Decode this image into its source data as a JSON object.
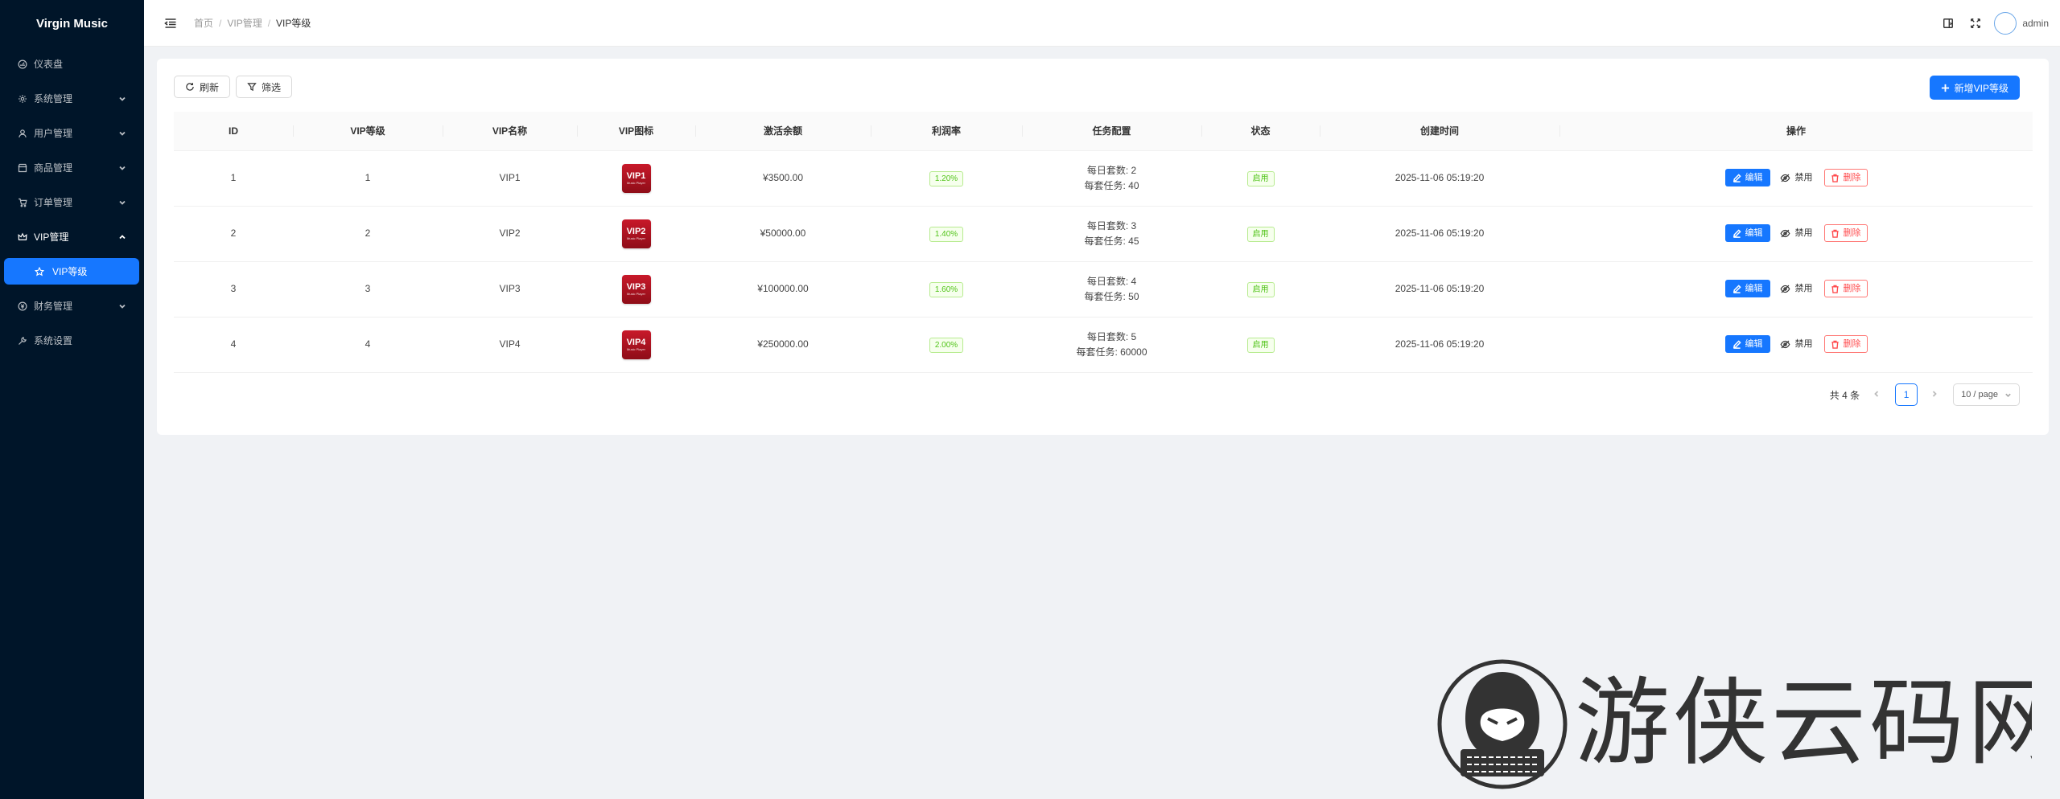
{
  "app": {
    "title": "Virgin Music"
  },
  "sidebar": {
    "items": [
      {
        "label": "仪表盘",
        "icon": "dashboard-icon",
        "expandable": false
      },
      {
        "label": "系统管理",
        "icon": "settings-icon",
        "expandable": true
      },
      {
        "label": "用户管理",
        "icon": "user-icon",
        "expandable": true
      },
      {
        "label": "商品管理",
        "icon": "shop-icon",
        "expandable": true
      },
      {
        "label": "订单管理",
        "icon": "cart-icon",
        "expandable": true
      },
      {
        "label": "VIP管理",
        "icon": "crown-icon",
        "expandable": true,
        "open": true
      },
      {
        "label": "财务管理",
        "icon": "finance-icon",
        "expandable": true
      },
      {
        "label": "系统设置",
        "icon": "wrench-icon",
        "expandable": false
      }
    ],
    "active_sub": {
      "label": "VIP等级",
      "icon": "star-icon"
    }
  },
  "header": {
    "breadcrumb": [
      "首页",
      "VIP管理",
      "VIP等级"
    ],
    "separator": "/",
    "username": "admin"
  },
  "toolbar": {
    "refresh_label": "刷新",
    "filter_label": "筛选",
    "add_label": "新增VIP等级"
  },
  "table": {
    "columns": [
      "ID",
      "VIP等级",
      "VIP名称",
      "VIP图标",
      "激活余额",
      "利润率",
      "任务配置",
      "状态",
      "创建时间",
      "操作"
    ],
    "rows": [
      {
        "id": "1",
        "level": "1",
        "name": "VIP1",
        "icon_text": "VIP1",
        "icon_sub": "Music Player",
        "balance": "¥3500.00",
        "rate": "1.20%",
        "task_daily": "每日套数: 2",
        "task_per": "每套任务: 40",
        "status": "启用",
        "created": "2025-11-06 05:19:20"
      },
      {
        "id": "2",
        "level": "2",
        "name": "VIP2",
        "icon_text": "VIP2",
        "icon_sub": "Music Player",
        "balance": "¥50000.00",
        "rate": "1.40%",
        "task_daily": "每日套数: 3",
        "task_per": "每套任务: 45",
        "status": "启用",
        "created": "2025-11-06 05:19:20"
      },
      {
        "id": "3",
        "level": "3",
        "name": "VIP3",
        "icon_text": "VIP3",
        "icon_sub": "Music Player",
        "balance": "¥100000.00",
        "rate": "1.60%",
        "task_daily": "每日套数: 4",
        "task_per": "每套任务: 50",
        "status": "启用",
        "created": "2025-11-06 05:19:20"
      },
      {
        "id": "4",
        "level": "4",
        "name": "VIP4",
        "icon_text": "VIP4",
        "icon_sub": "Music Player",
        "balance": "¥250000.00",
        "rate": "2.00%",
        "task_daily": "每日套数: 5",
        "task_per": "每套任务: 60000",
        "status": "启用",
        "created": "2025-11-06 05:19:20"
      }
    ],
    "actions": {
      "edit": "编辑",
      "disable": "禁用",
      "delete": "删除"
    }
  },
  "pagination": {
    "total": "共 4 条",
    "current_page": "1",
    "page_size": "10 / page"
  },
  "watermark": {
    "text": "游侠云码网"
  },
  "colors": {
    "sidebar_bg": "#001529",
    "primary": "#1677ff",
    "success": "#52c41a",
    "danger": "#ff4d4f",
    "page_bg": "#f0f2f5"
  }
}
